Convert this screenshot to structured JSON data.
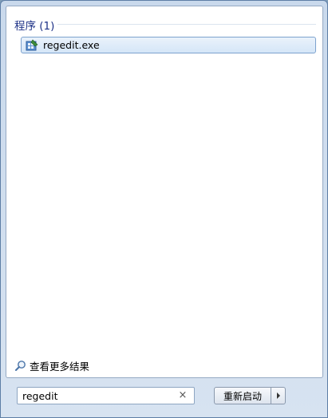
{
  "results": {
    "section_title": "程序 (1)",
    "items": [
      {
        "label": "regedit.exe",
        "icon": "regedit-icon"
      }
    ],
    "more_results_label": "查看更多结果"
  },
  "search": {
    "value": "regedit",
    "clear_label": "×"
  },
  "shutdown": {
    "label": "重新启动"
  }
}
